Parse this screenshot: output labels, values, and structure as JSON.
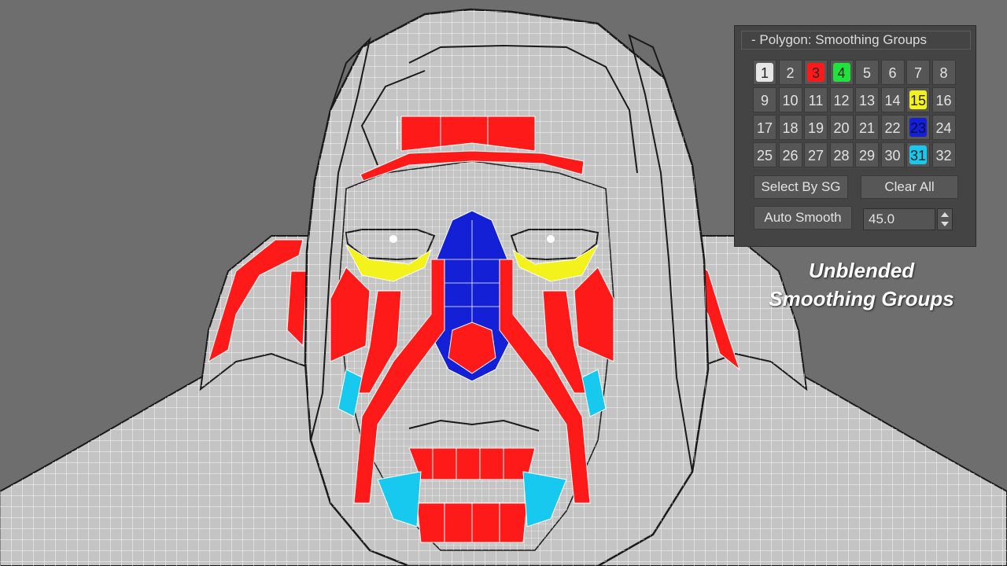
{
  "panel": {
    "title": "- Polygon: Smoothing Groups",
    "groups": [
      {
        "n": "1",
        "active": true,
        "color": "#e6e6e6"
      },
      {
        "n": "2",
        "active": false
      },
      {
        "n": "3",
        "active": true,
        "color": "#ff1a1a"
      },
      {
        "n": "4",
        "active": true,
        "color": "#21e23a"
      },
      {
        "n": "5",
        "active": false
      },
      {
        "n": "6",
        "active": false
      },
      {
        "n": "7",
        "active": false
      },
      {
        "n": "8",
        "active": false
      },
      {
        "n": "9",
        "active": false
      },
      {
        "n": "10",
        "active": false
      },
      {
        "n": "11",
        "active": false
      },
      {
        "n": "12",
        "active": false
      },
      {
        "n": "13",
        "active": false
      },
      {
        "n": "14",
        "active": false
      },
      {
        "n": "15",
        "active": true,
        "color": "#f3f21c"
      },
      {
        "n": "16",
        "active": false
      },
      {
        "n": "17",
        "active": false
      },
      {
        "n": "18",
        "active": false
      },
      {
        "n": "19",
        "active": false
      },
      {
        "n": "20",
        "active": false
      },
      {
        "n": "21",
        "active": false
      },
      {
        "n": "22",
        "active": false
      },
      {
        "n": "23",
        "active": true,
        "color": "#1320d6"
      },
      {
        "n": "24",
        "active": false
      },
      {
        "n": "25",
        "active": false
      },
      {
        "n": "26",
        "active": false
      },
      {
        "n": "27",
        "active": false
      },
      {
        "n": "28",
        "active": false
      },
      {
        "n": "29",
        "active": false
      },
      {
        "n": "30",
        "active": false
      },
      {
        "n": "31",
        "active": true,
        "color": "#18c9ef"
      },
      {
        "n": "32",
        "active": false
      }
    ],
    "select_by_sg_label": "Select By SG",
    "clear_all_label": "Clear All",
    "auto_smooth_label": "Auto Smooth",
    "auto_smooth_threshold": "45.0"
  },
  "caption": {
    "line1": "Unblended",
    "line2": "Smoothing Groups"
  },
  "colors": {
    "viewport_bg": "#6e6e6e",
    "mesh_base": "#c4c4c4",
    "wire": "#ffffff",
    "sg_red": "#ff1a1a",
    "sg_blue": "#1320d6",
    "sg_yellow": "#f3f21c",
    "sg_cyan": "#18c9ef"
  }
}
